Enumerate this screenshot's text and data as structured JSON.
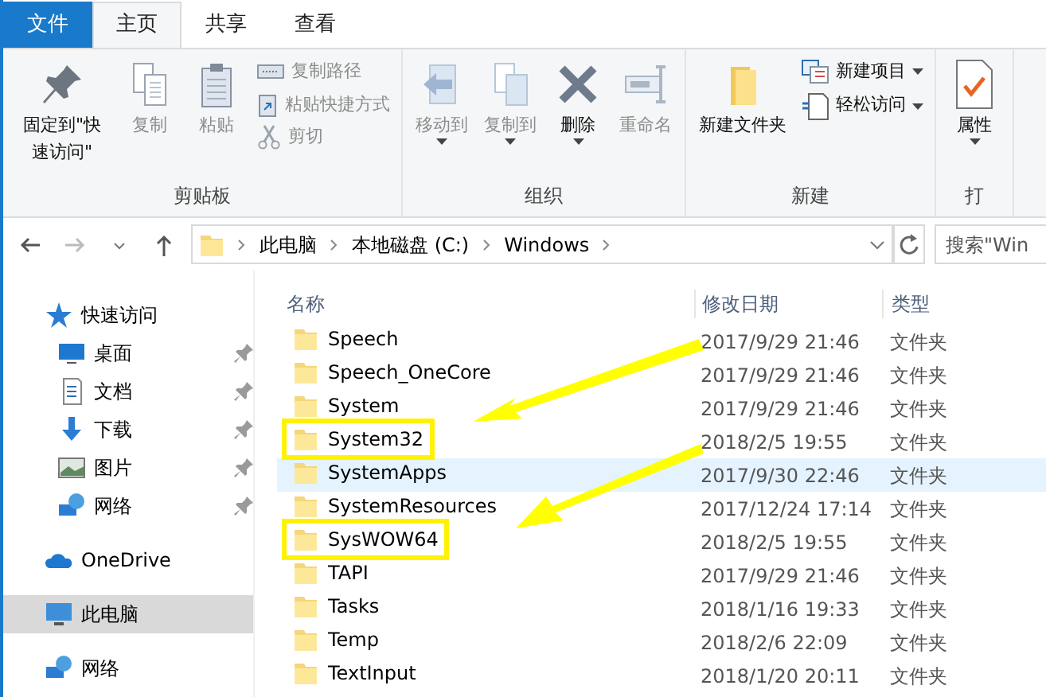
{
  "ribbon_tabs": [
    {
      "label": "文件",
      "kind": "file",
      "selected": false
    },
    {
      "label": "主页",
      "kind": "tab",
      "selected": true
    },
    {
      "label": "共享",
      "kind": "tab",
      "selected": false
    },
    {
      "label": "查看",
      "kind": "tab",
      "selected": false
    }
  ],
  "ribbon_groups": [
    {
      "label": "剪贴板",
      "items": [
        {
          "kind": "large",
          "label": "固定到\"快速访问\"",
          "disabled": false,
          "dropdown": false
        },
        {
          "kind": "large",
          "label": "复制",
          "disabled": true,
          "dropdown": false
        },
        {
          "kind": "large",
          "label": "粘贴",
          "disabled": true,
          "dropdown": false
        },
        {
          "kind": "small",
          "label": "复制路径",
          "disabled": true,
          "dropdown": false
        },
        {
          "kind": "small",
          "label": "粘贴快捷方式",
          "disabled": true,
          "dropdown": false
        },
        {
          "kind": "small",
          "label": "剪切",
          "disabled": true,
          "dropdown": false
        }
      ]
    },
    {
      "label": "组织",
      "items": [
        {
          "kind": "large",
          "label": "移动到",
          "disabled": true,
          "dropdown": true
        },
        {
          "kind": "large",
          "label": "复制到",
          "disabled": true,
          "dropdown": true
        },
        {
          "kind": "large",
          "label": "删除",
          "disabled": false,
          "dropdown": true
        },
        {
          "kind": "large",
          "label": "重命名",
          "disabled": true,
          "dropdown": false
        }
      ]
    },
    {
      "label": "新建",
      "items": [
        {
          "kind": "large",
          "label": "新建文件夹",
          "disabled": false,
          "dropdown": false
        },
        {
          "kind": "small",
          "label": "新建项目",
          "disabled": false,
          "dropdown": true
        },
        {
          "kind": "small",
          "label": "轻松访问",
          "disabled": false,
          "dropdown": true
        }
      ]
    },
    {
      "label": "打",
      "items": [
        {
          "kind": "large",
          "label": "属性",
          "disabled": false,
          "dropdown": true
        }
      ]
    }
  ],
  "address_bar": {
    "breadcrumbs": [
      "此电脑",
      "本地磁盘 (C:)",
      "Windows"
    ]
  },
  "search": {
    "placeholder": "搜索\"Win"
  },
  "sidebar": {
    "items": [
      {
        "label": "快速访问",
        "selected": false,
        "pinned": false,
        "children": [
          {
            "label": "桌面",
            "selected": false,
            "pinned": true
          },
          {
            "label": "文档",
            "selected": false,
            "pinned": true
          },
          {
            "label": "下载",
            "selected": false,
            "pinned": true
          },
          {
            "label": "图片",
            "selected": false,
            "pinned": true
          },
          {
            "label": "网络",
            "selected": false,
            "pinned": true
          }
        ]
      },
      {
        "label": "OneDrive",
        "selected": false,
        "pinned": false
      },
      {
        "label": "此电脑",
        "selected": true,
        "pinned": false
      },
      {
        "label": "网络",
        "selected": false,
        "pinned": false
      }
    ]
  },
  "table": {
    "columns": [
      "名称",
      "修改日期",
      "类型"
    ],
    "rows": [
      {
        "name": "Speech",
        "date": "2017/9/29 21:46",
        "type": "文件夹",
        "selected": false,
        "highlighted": false
      },
      {
        "name": "Speech_OneCore",
        "date": "2017/9/29 21:46",
        "type": "文件夹",
        "selected": false,
        "highlighted": false
      },
      {
        "name": "System",
        "date": "2017/9/29 21:46",
        "type": "文件夹",
        "selected": false,
        "highlighted": false
      },
      {
        "name": "System32",
        "date": "2018/2/5 19:55",
        "type": "文件夹",
        "selected": false,
        "highlighted": true
      },
      {
        "name": "SystemApps",
        "date": "2017/9/30 22:46",
        "type": "文件夹",
        "selected": true,
        "highlighted": false
      },
      {
        "name": "SystemResources",
        "date": "2017/12/24 17:14",
        "type": "文件夹",
        "selected": false,
        "highlighted": false
      },
      {
        "name": "SysWOW64",
        "date": "2018/2/5 19:55",
        "type": "文件夹",
        "selected": false,
        "highlighted": true
      },
      {
        "name": "TAPI",
        "date": "2017/9/29 21:46",
        "type": "文件夹",
        "selected": false,
        "highlighted": false
      },
      {
        "name": "Tasks",
        "date": "2018/1/16 19:33",
        "type": "文件夹",
        "selected": false,
        "highlighted": false
      },
      {
        "name": "Temp",
        "date": "2018/2/6 22:09",
        "type": "文件夹",
        "selected": false,
        "highlighted": false
      },
      {
        "name": "TextInput",
        "date": "2018/1/20 20:11",
        "type": "文件夹",
        "selected": false,
        "highlighted": false
      }
    ]
  }
}
